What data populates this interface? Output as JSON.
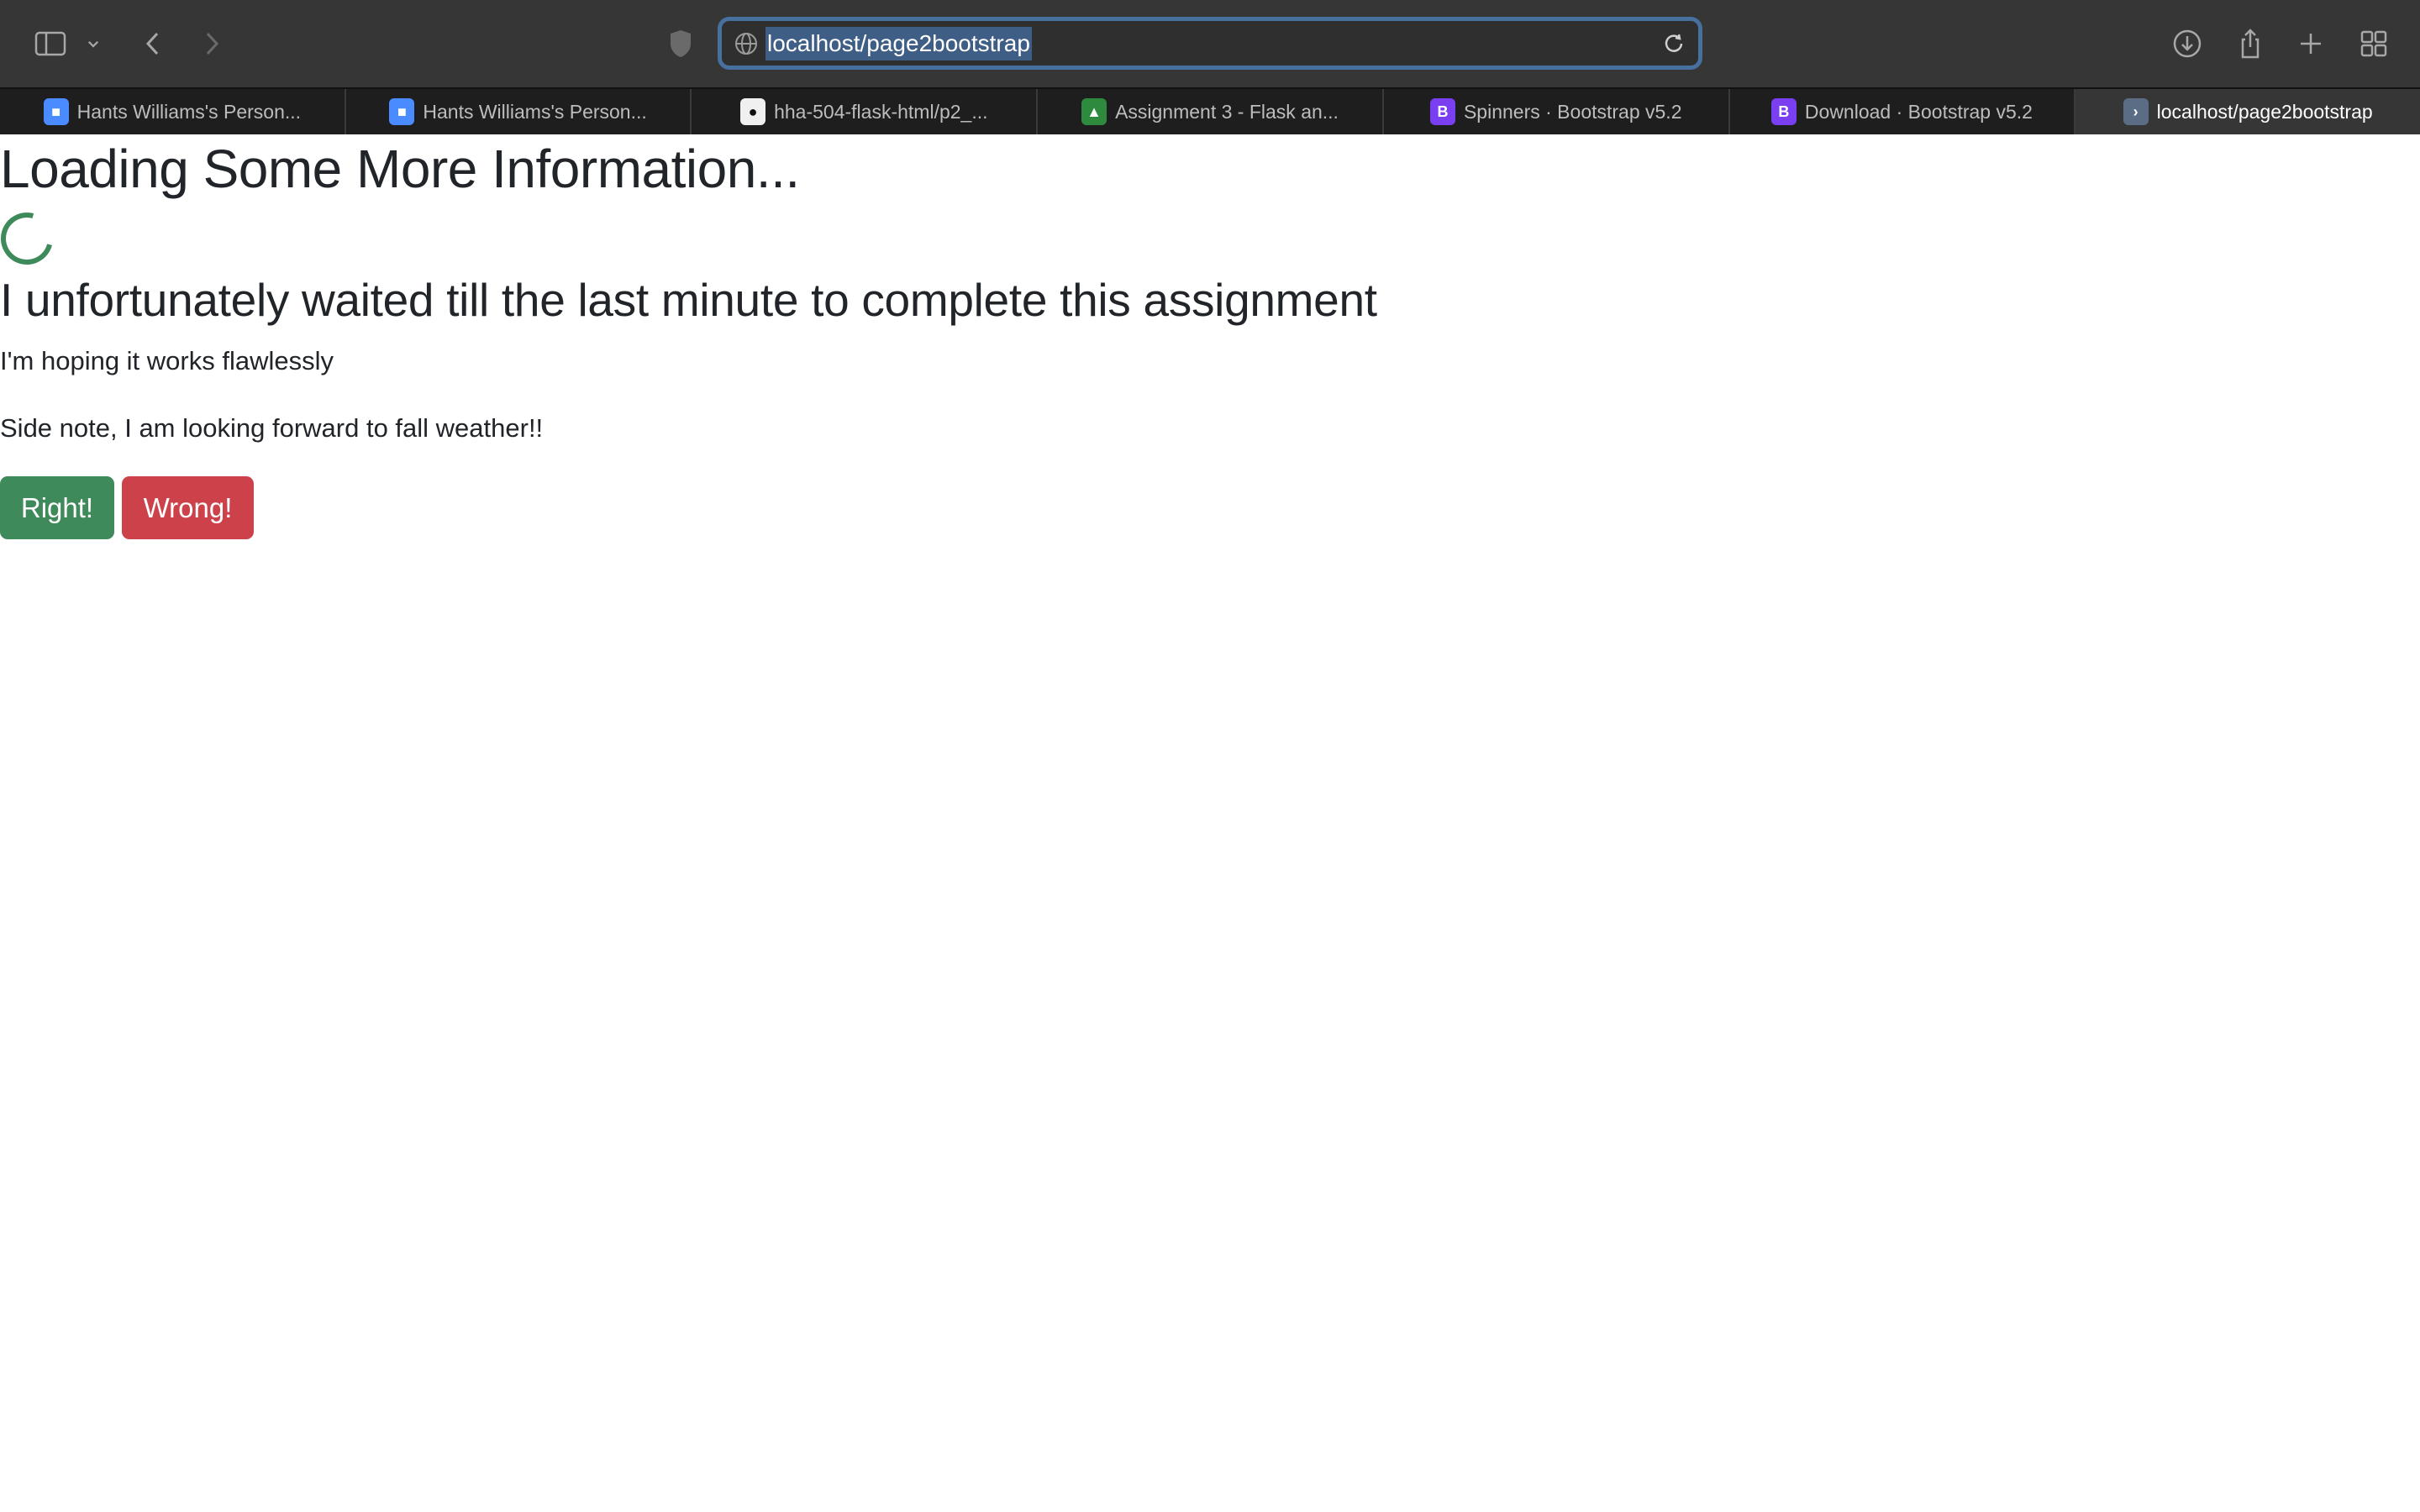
{
  "browser": {
    "url": "localhost/page2bootstrap",
    "tabs": [
      {
        "title": "Hants Williams's Person...",
        "icon": "zoom-icon",
        "color": "#4a8cff"
      },
      {
        "title": "Hants Williams's Person...",
        "icon": "zoom-icon",
        "color": "#4a8cff"
      },
      {
        "title": "hha-504-flask-html/p2_...",
        "icon": "github-icon",
        "color": "#f0f0f0"
      },
      {
        "title": "Assignment 3 - Flask an...",
        "icon": "classroom-icon",
        "color": "#2e8b3e"
      },
      {
        "title": "Spinners · Bootstrap v5.2",
        "icon": "bootstrap-icon",
        "color": "#7b3ff2"
      },
      {
        "title": "Download · Bootstrap v5.2",
        "icon": "bootstrap-icon",
        "color": "#7b3ff2"
      },
      {
        "title": "localhost/page2bootstrap",
        "icon": "terminal-icon",
        "color": "#5a6d85",
        "active": true
      }
    ]
  },
  "page": {
    "heading": "Loading Some More Information...",
    "subheading": "I unfortunately waited till the last minute to complete this assignment",
    "paragraph1": "I'm hoping it works flawlessly",
    "paragraph2": "Side note, I am looking forward to fall weather!!",
    "right_button": "Right!",
    "wrong_button": "Wrong!",
    "colors": {
      "success": "#3f8a5a",
      "danger": "#cc414a"
    }
  }
}
